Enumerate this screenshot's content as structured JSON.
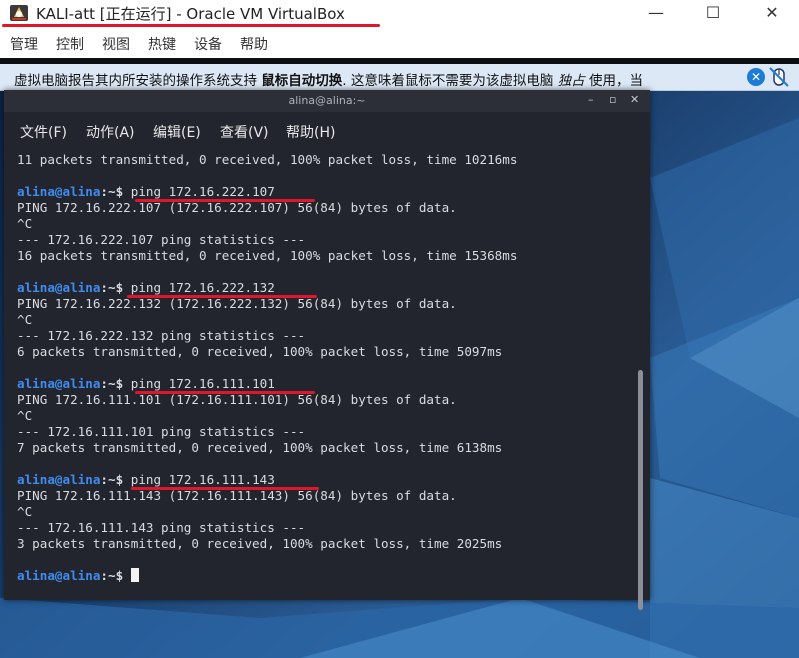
{
  "window": {
    "title": "KALI-att [正在运行] - Oracle VM VirtualBox",
    "minimize": "—",
    "maximize": "☐",
    "close": "✕"
  },
  "menubar": [
    "管理",
    "控制",
    "视图",
    "热键",
    "设备",
    "帮助"
  ],
  "notification": {
    "part1": "虚拟电脑报告其内所安装的操作系统支持 ",
    "bold": "鼠标自动切换",
    "part2": ". 这意味着鼠标不需要为该虚拟电脑 ",
    "italic": "独占",
    "part3": " 使用，当",
    "close_glyph": "✕"
  },
  "terminal": {
    "title": "alina@alina:~",
    "controls": [
      "–",
      "▫",
      "✕"
    ],
    "menu": [
      "文件(F)",
      "动作(A)",
      "编辑(E)",
      "查看(V)",
      "帮助(H)"
    ],
    "prompt_user": "alina@alina",
    "prompt_rest": ":~$ ",
    "first_line": "11 packets transmitted, 0 received, 100% packet loss, time 10216ms",
    "blocks": [
      {
        "command": "ping 172.16.222.107",
        "ping": "PING 172.16.222.107 (172.16.222.107) 56(84) bytes of data.",
        "interrupt": "^C",
        "stats_header": "--- 172.16.222.107 ping statistics ---",
        "stats": "16 packets transmitted, 0 received, 100% packet loss, time 15368ms"
      },
      {
        "command": "ping 172.16.222.132",
        "ping": "PING 172.16.222.132 (172.16.222.132) 56(84) bytes of data.",
        "interrupt": "^C",
        "stats_header": "--- 172.16.222.132 ping statistics ---",
        "stats": "6 packets transmitted, 0 received, 100% packet loss, time 5097ms"
      },
      {
        "command": "ping 172.16.111.101",
        "ping": "PING 172.16.111.101 (172.16.111.101) 56(84) bytes of data.",
        "interrupt": "^C",
        "stats_header": "--- 172.16.111.101 ping statistics ---",
        "stats": "7 packets transmitted, 0 received, 100% packet loss, time 6138ms"
      },
      {
        "command": "ping 172.16.111.143",
        "ping": "PING 172.16.111.143 (172.16.111.143) 56(84) bytes of data.",
        "interrupt": "^C",
        "stats_header": "--- 172.16.111.143 ping statistics ---",
        "stats": "3 packets transmitted, 0 received, 100% packet loss, time 2025ms"
      }
    ]
  }
}
